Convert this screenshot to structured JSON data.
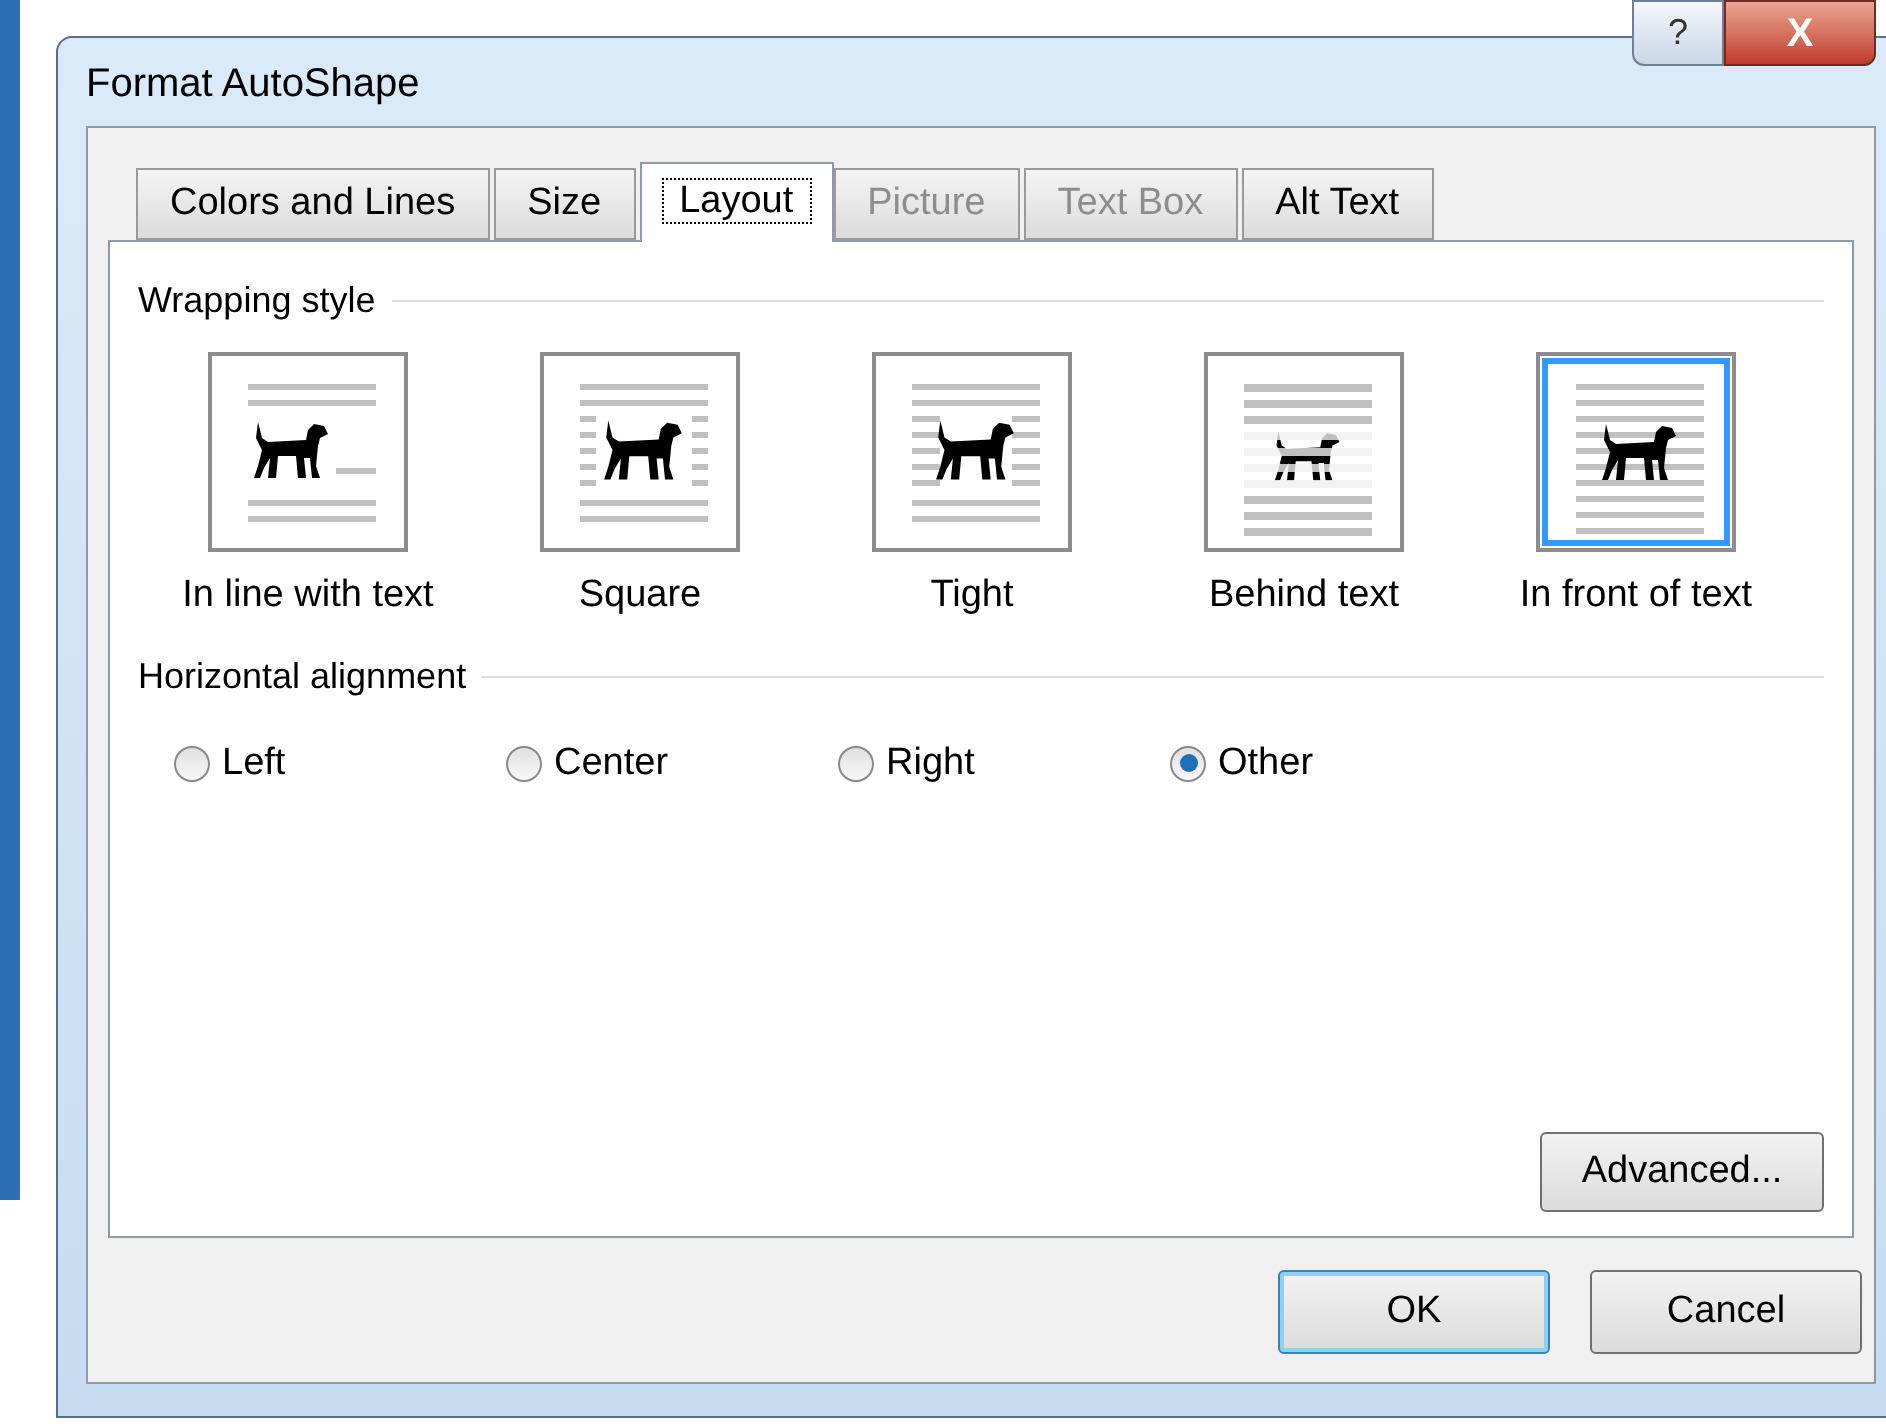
{
  "window": {
    "title": "Format AutoShape",
    "help_button": "?",
    "close_button": "X"
  },
  "tabs": [
    {
      "label": "Colors and Lines",
      "selected": false,
      "disabled": false
    },
    {
      "label": "Size",
      "selected": false,
      "disabled": false
    },
    {
      "label": "Layout",
      "selected": true,
      "disabled": false
    },
    {
      "label": "Picture",
      "selected": false,
      "disabled": true
    },
    {
      "label": "Text Box",
      "selected": false,
      "disabled": true
    },
    {
      "label": "Alt Text",
      "selected": false,
      "disabled": false
    }
  ],
  "wrapping_style": {
    "heading": "Wrapping style",
    "options": [
      {
        "kind": "inline",
        "label": "In line with text",
        "selected": false
      },
      {
        "kind": "square",
        "label": "Square",
        "selected": false
      },
      {
        "kind": "tight",
        "label": "Tight",
        "selected": false
      },
      {
        "kind": "behind",
        "label": "Behind text",
        "selected": false
      },
      {
        "kind": "front",
        "label": "In front of text",
        "selected": true
      }
    ]
  },
  "horizontal_alignment": {
    "heading": "Horizontal alignment",
    "options": [
      {
        "label": "Left",
        "selected": false
      },
      {
        "label": "Center",
        "selected": false
      },
      {
        "label": "Right",
        "selected": false
      },
      {
        "label": "Other",
        "selected": true
      }
    ]
  },
  "advanced_button": {
    "label": "Advanced..."
  },
  "buttons": [
    {
      "label": "OK",
      "default": true
    },
    {
      "label": "Cancel",
      "default": false
    }
  ]
}
